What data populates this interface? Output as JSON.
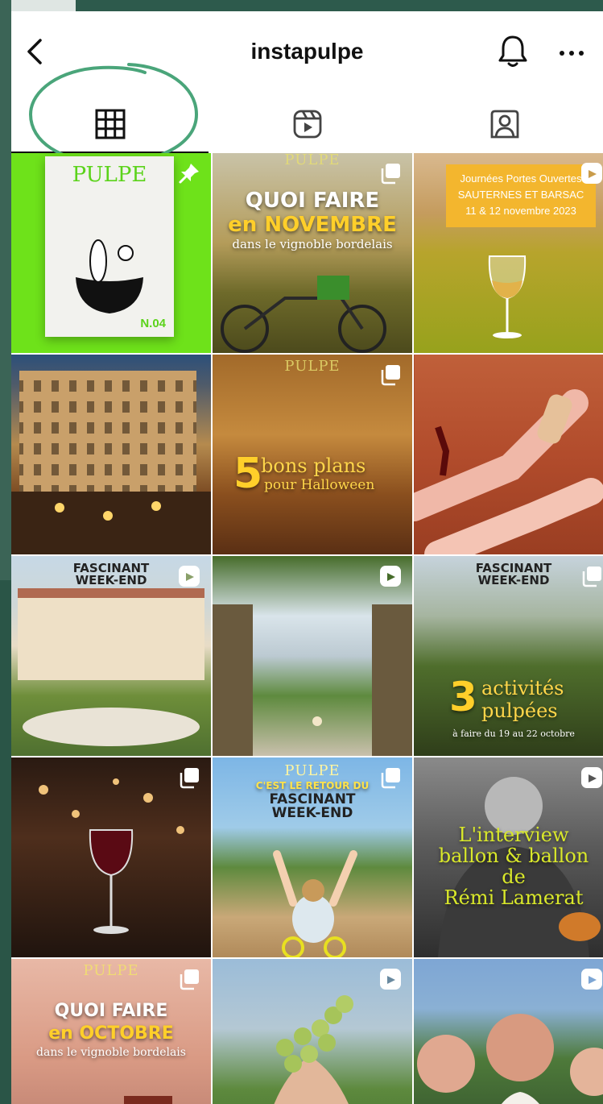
{
  "header": {
    "title": "instapulpe",
    "back_icon": "chevron-left-icon",
    "bell_icon": "bell-icon",
    "more_icon": "more-horizontal-icon"
  },
  "tabs": [
    {
      "name": "posts-grid",
      "icon": "grid-icon",
      "active": true
    },
    {
      "name": "reels",
      "icon": "reels-icon",
      "active": false
    },
    {
      "name": "tagged",
      "icon": "tagged-person-icon",
      "active": false
    }
  ],
  "colors": {
    "annotation_circle": "#4aa57a",
    "frame": "#2d5a4c",
    "brand_yellow": "#f3b62e"
  },
  "posts": {
    "p1": {
      "brand": "PULPE",
      "issue": "N.04",
      "pinned": true
    },
    "p2": {
      "brand": "PULPE",
      "line1": "QUOI FAIRE",
      "line2": "en NOVEMBRE",
      "line3": "dans le vignoble bordelais"
    },
    "p3": {
      "box": "Journées Portes Ouvertes\nSAUTERNES ET BARSAC\n11 & 12 novembre 2023"
    },
    "p4": {},
    "p5": {
      "brand": "PULPE",
      "number": "5",
      "line1": "bons plans",
      "line2": "pour Halloween"
    },
    "p6": {},
    "p7": {
      "logo": "FASCINANT\nWEEK-END"
    },
    "p8": {},
    "p9": {
      "logo": "FASCINANT\nWEEK-END",
      "number": "3",
      "line1": "activités",
      "line2": "pulpées",
      "line3": "à faire du 19 au 22 octobre"
    },
    "p10": {},
    "p11": {
      "brand": "PULPE",
      "line1": "C'EST LE RETOUR DU",
      "logo": "FASCINANT\nWEEK-END"
    },
    "p12": {
      "line1": "L'interview",
      "line2": "ballon & ballon",
      "line3": "de",
      "line4": "Rémi Lamerat"
    },
    "p13": {
      "brand": "PULPE",
      "line1": "QUOI FAIRE",
      "line2": "en OCTOBRE",
      "line3": "dans le vignoble bordelais"
    },
    "p14": {},
    "p15": {}
  }
}
